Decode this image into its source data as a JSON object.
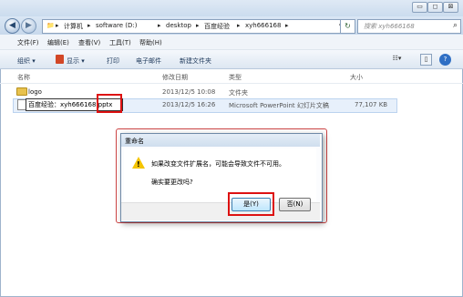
{
  "window": {
    "controls": {
      "minimize": "▭",
      "maximize": "◻",
      "close": "⊠"
    }
  },
  "address_bar": {
    "segments": [
      "计算机",
      "software (D:)",
      "desktop",
      "百度经验",
      "xyh666168"
    ],
    "separator": "▸",
    "dropdown_glyph": "▾",
    "refresh_glyph": "↻",
    "search_placeholder": "搜索 xyh666168",
    "search_icon": "⌕"
  },
  "menu": [
    "文件(F)",
    "编辑(E)",
    "查看(V)",
    "工具(T)",
    "帮助(H)"
  ],
  "command_bar": {
    "organize": "组织 ▾",
    "show": "显示 ▾",
    "print": "打印",
    "email": "电子邮件",
    "new_folder": "新建文件夹"
  },
  "columns": {
    "name": "名称",
    "modified": "修改日期",
    "type": "类型",
    "size": "大小"
  },
  "files": [
    {
      "name": "logo",
      "modified": "2013/12/5 10:08",
      "type": "文件夹",
      "size": ""
    },
    {
      "name": "百度经验：xyh666168.pptx",
      "modified": "2013/12/5 16:26",
      "type": "Microsoft PowerPoint 幻灯片文稿",
      "size": "77,107 KB"
    }
  ],
  "dialog": {
    "title": "重命名",
    "message": "如果改变文件扩展名，可能会导致文件不可用。",
    "question": "确实要更改吗?",
    "yes_label": "是(Y)",
    "no_label": "否(N)"
  },
  "colors": {
    "accent_red": "#dd1111",
    "selection": "#e7f0fb",
    "warning": "#f4c400"
  }
}
